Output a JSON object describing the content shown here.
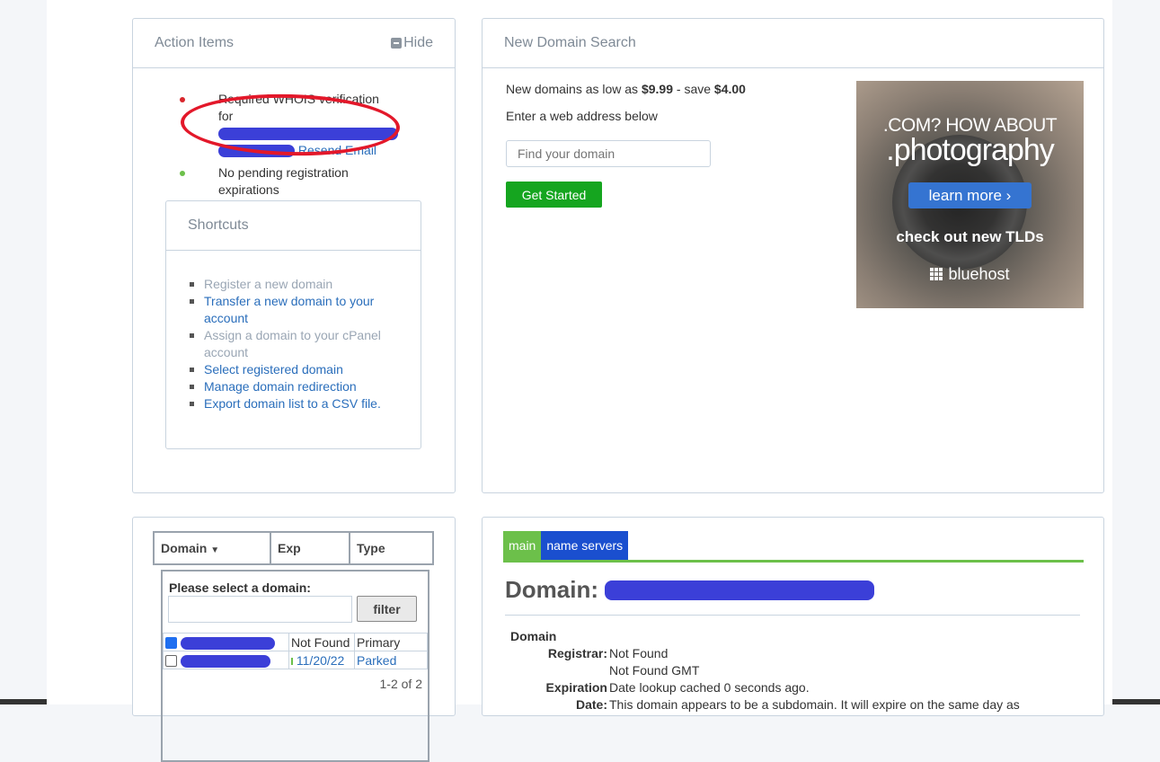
{
  "action_items": {
    "title": "Action Items",
    "hide_label": "Hide",
    "items": [
      {
        "text": "Required WHOIS verification for",
        "link": "Resend Email",
        "status": "error"
      },
      {
        "text": "No pending registration expirations",
        "status": "ok"
      }
    ]
  },
  "shortcuts": {
    "title": "Shortcuts",
    "items": [
      "Register a new domain",
      "Transfer a new domain to your account",
      "Assign a domain to your cPanel account",
      "Select registered domain",
      "Manage domain redirection",
      "Export domain list to a CSV file."
    ]
  },
  "new_domain_search": {
    "title": "New Domain Search",
    "promo_prefix": "New domains as low as ",
    "promo_price": "$9.99",
    "promo_mid": " - save ",
    "promo_save": "$4.00",
    "enter_label": "Enter a web address below",
    "search_placeholder": "Find your domain",
    "button_label": "Get Started"
  },
  "ad": {
    "line1": ".COM? HOW ABOUT",
    "line2": ".photography",
    "button": "learn more",
    "line3": "check out new TLDs",
    "brand": "bluehost"
  },
  "domain_table": {
    "headers": [
      "Domain",
      "Exp",
      "Type"
    ],
    "select_label": "Please select a domain:",
    "filter_label": "filter",
    "rows": [
      {
        "exp": "Not Found",
        "type": "Primary",
        "checked": true
      },
      {
        "exp": "11/20/22",
        "type": "Parked",
        "checked": false
      }
    ],
    "page_info": "1-2 of 2"
  },
  "domain_detail": {
    "tabs": [
      "main",
      "name servers"
    ],
    "title": "Domain:",
    "section": "Domain",
    "registrar_label": "Registrar:",
    "registrar_value": "Not Found",
    "registrar_value2": "Not Found GMT",
    "expiration_label": "Expiration",
    "expiration_value": "Date lookup cached 0 seconds ago.",
    "date_label": "Date:",
    "date_value": "This domain appears to be a subdomain. It will expire on the same day as"
  },
  "colors": {
    "link": "#2a6ebb",
    "green_button": "#15a51f",
    "tab_main": "#6cc04a",
    "tab_ns": "#1a4fcf",
    "annotation_red": "#e3182a",
    "redaction_blue": "#3b3fd8"
  }
}
